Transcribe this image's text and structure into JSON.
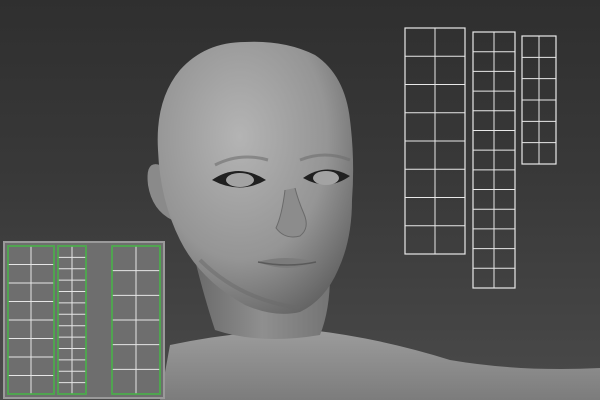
{
  "viewport": {
    "background_top": "#2e2e2e",
    "background_bottom": "#4b4b4b"
  },
  "model": {
    "name": "head-bust-model",
    "skin_color": "#9a9a9a"
  },
  "uv_strips": [
    {
      "name": "uv-strip-left",
      "columns": 2,
      "rows": 8
    },
    {
      "name": "uv-strip-middle",
      "columns": 2,
      "rows": 13
    },
    {
      "name": "uv-strip-right",
      "columns": 2,
      "rows": 6
    }
  ],
  "uv_inset": {
    "panel_color": "#6e6e6e",
    "border_color": "#3fae3f",
    "grid_color": "#e6e6e6"
  }
}
